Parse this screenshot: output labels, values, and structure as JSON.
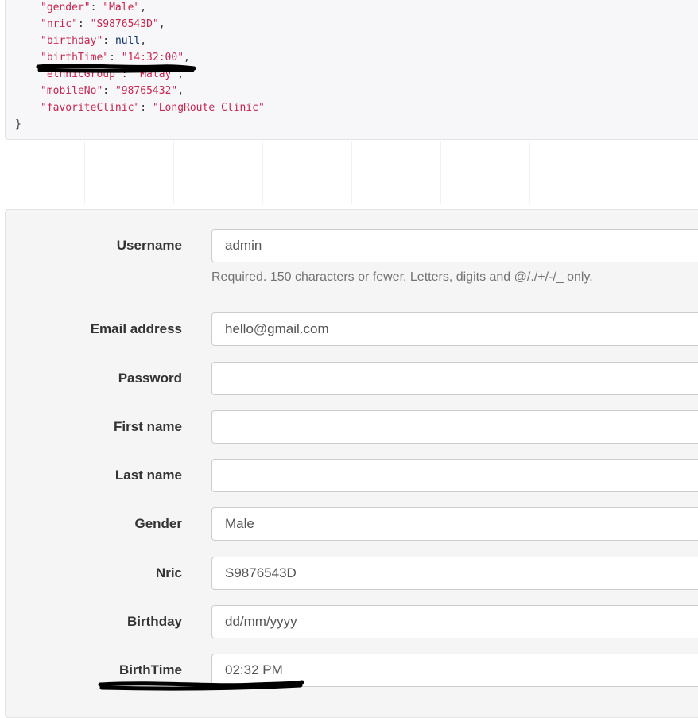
{
  "json_preview": {
    "lines": [
      {
        "key": "\"gender\"",
        "value": "\"Male\"",
        "type": "string",
        "comma": true
      },
      {
        "key": "\"nric\"",
        "value": "\"S9876543D\"",
        "type": "string",
        "comma": true
      },
      {
        "key": "\"birthday\"",
        "value": "null",
        "type": "null",
        "comma": true
      },
      {
        "key": "\"birthTime\"",
        "value": "\"14:32:00\"",
        "type": "string",
        "comma": true
      },
      {
        "key": "\"ethnicGroup\"",
        "value": "\"Malay\"",
        "type": "string",
        "comma": true
      },
      {
        "key": "\"mobileNo\"",
        "value": "\"98765432\"",
        "type": "string",
        "comma": true
      },
      {
        "key": "\"favoriteClinic\"",
        "value": "\"LongRoute Clinic\"",
        "type": "string",
        "comma": false
      }
    ],
    "closing_brace": "}"
  },
  "form": {
    "username": {
      "label": "Username",
      "value": "admin",
      "help": "Required. 150 characters or fewer. Letters, digits and @/./+/-/_ only."
    },
    "email": {
      "label": "Email address",
      "value": "hello@gmail.com"
    },
    "password": {
      "label": "Password",
      "value": ""
    },
    "first_name": {
      "label": "First name",
      "value": ""
    },
    "last_name": {
      "label": "Last name",
      "value": ""
    },
    "gender": {
      "label": "Gender",
      "value": "Male"
    },
    "nric": {
      "label": "Nric",
      "value": "S9876543D"
    },
    "birthday": {
      "label": "Birthday",
      "placeholder": "dd/mm/yyyy"
    },
    "birth_time": {
      "label": "BirthTime",
      "value": "02:32 PM"
    }
  },
  "colors": {
    "json_key": "#c7254e",
    "json_string": "#c7254e",
    "ink": "#000000"
  }
}
